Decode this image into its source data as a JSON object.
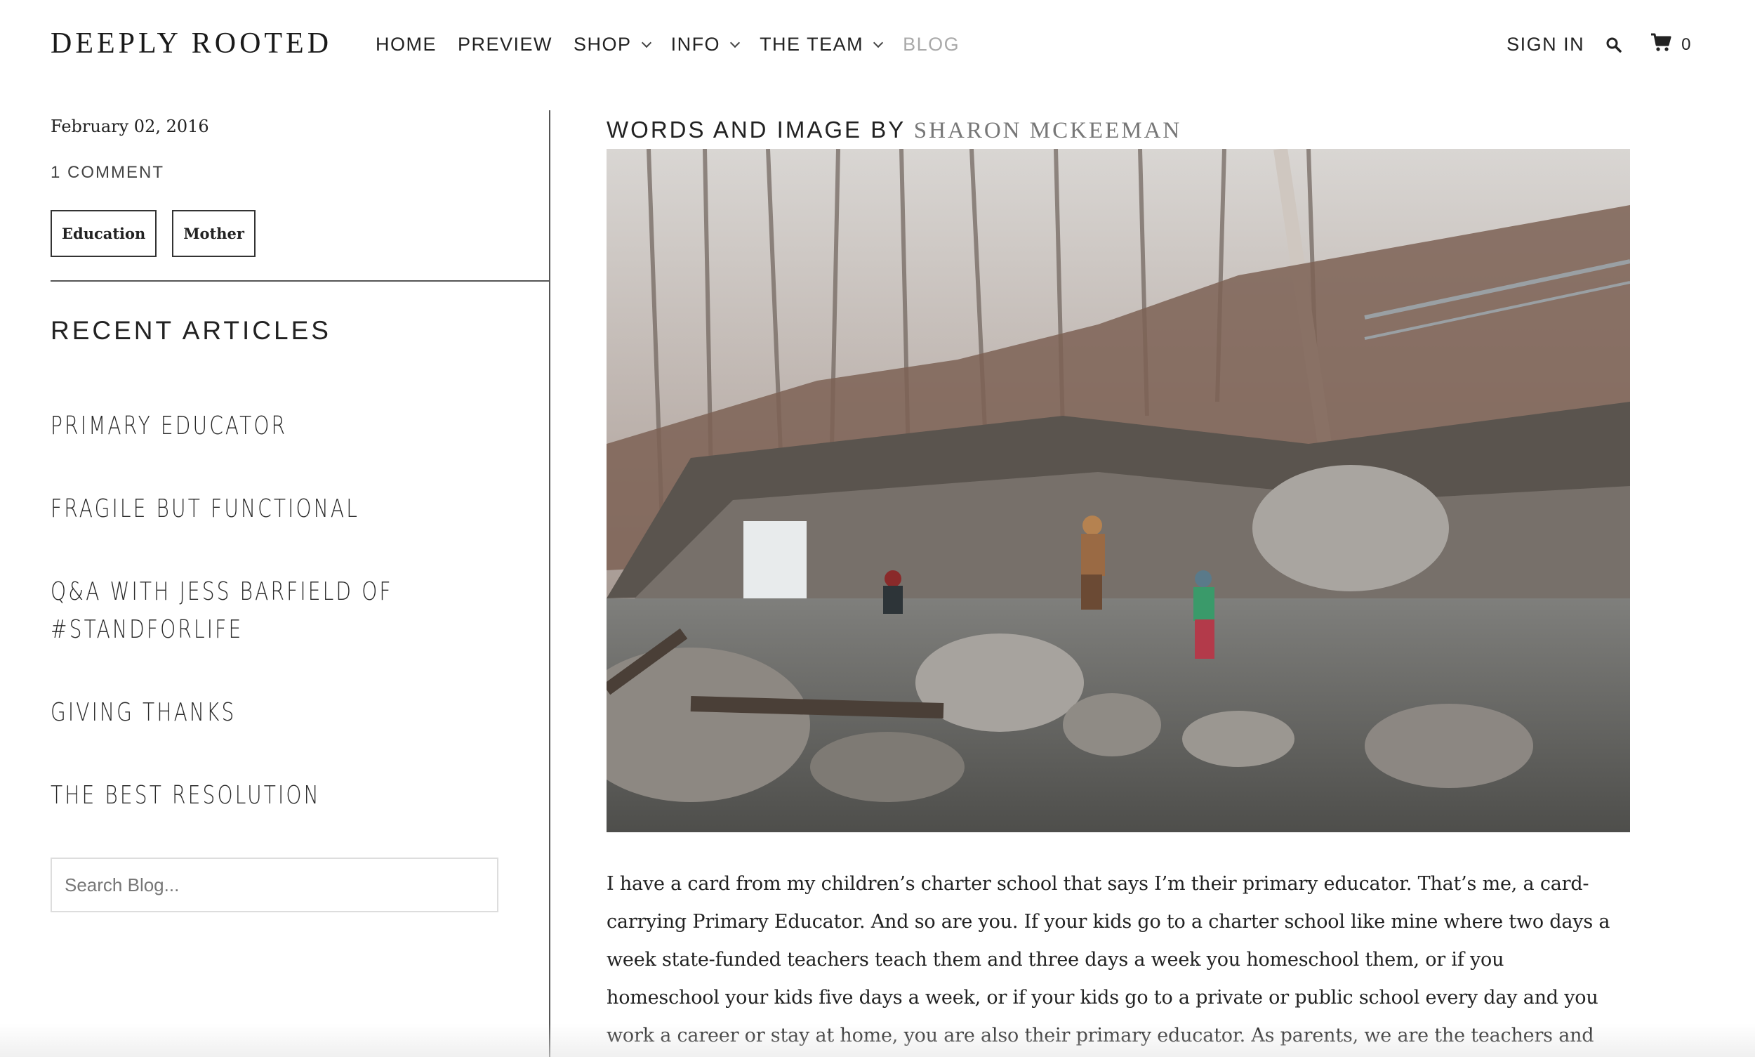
{
  "header": {
    "logo": "DEEPLY ROOTED",
    "nav": [
      {
        "label": "HOME",
        "has_dropdown": false,
        "active": false
      },
      {
        "label": "PREVIEW",
        "has_dropdown": false,
        "active": false
      },
      {
        "label": "SHOP",
        "has_dropdown": true,
        "active": false
      },
      {
        "label": "INFO",
        "has_dropdown": true,
        "active": false
      },
      {
        "label": "THE TEAM",
        "has_dropdown": true,
        "active": false
      },
      {
        "label": "BLOG",
        "has_dropdown": false,
        "active": true
      }
    ],
    "sign_in": "SIGN IN",
    "search_icon": "search-icon",
    "cart_icon": "cart-icon",
    "cart_count": "0"
  },
  "sidebar": {
    "date": "February 02, 2016",
    "comments": "1 COMMENT",
    "tags": [
      "Education",
      "Mother"
    ],
    "recent_heading": "RECENT ARTICLES",
    "recent_articles": [
      "PRIMARY EDUCATOR",
      "FRAGILE BUT FUNCTIONAL",
      "Q&A WITH JESS BARFIELD OF #STANDFORLIFE",
      "GIVING THANKS",
      "THE BEST RESOLUTION"
    ],
    "search_placeholder": "Search Blog..."
  },
  "article": {
    "byline_prefix": "WORDS AND IMAGE BY ",
    "author": "SHARON MCKEEMAN",
    "hero_image": "creek-waterfall-family-photo",
    "body": "I have a card from my children’s charter school that says I’m their primary educator. That’s me, a card-carrying Primary Educator. And so are you. If your kids go to a charter school like mine where two days a week state-funded teachers teach them and three days a week you homeschool them, or if you homeschool your kids five days a week, or if your kids go to a private or public school every day and you work a career or stay at home, you are also their primary educator. As parents, we are the teachers and examples that have the most impact on our"
  },
  "colors": {
    "text": "#222222",
    "muted_nav": "#a9a9a9",
    "author": "#777777",
    "rule": "#555555"
  }
}
